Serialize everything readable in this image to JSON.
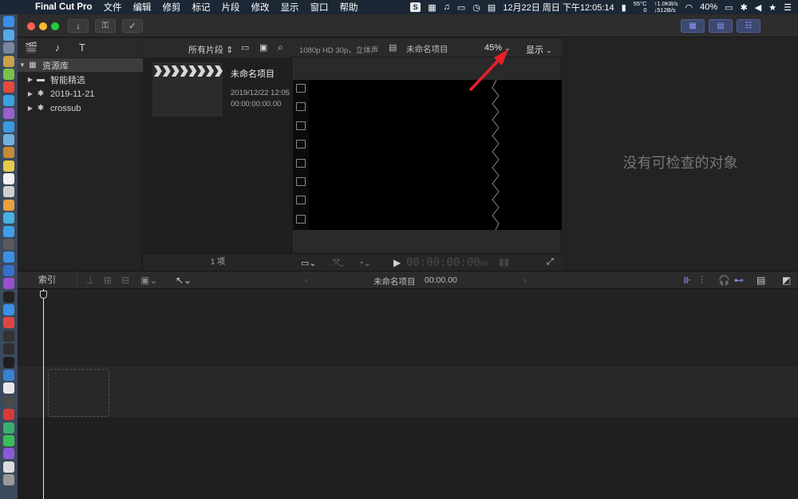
{
  "menubar": {
    "app_name": "Final Cut Pro",
    "items": [
      "文件",
      "编辑",
      "修剪",
      "标记",
      "片段",
      "修改",
      "显示",
      "窗口",
      "帮助"
    ],
    "status": {
      "temp": "55°C",
      "temp_sub": "0",
      "net_up": "↑1.0KB/s",
      "net_down": "↓512B/s",
      "date_time": "12月22日 周日 下午12:05:14",
      "battery": "40%"
    }
  },
  "library": {
    "root_label": "资源库",
    "items": [
      "智能精选",
      "2019-11-21",
      "crossub"
    ]
  },
  "browser": {
    "filter_label": "所有片段",
    "clip": {
      "name": "未命名项目",
      "date": "2019/12/22 12:05",
      "duration": "00:00:00:00.00"
    },
    "item_count": "1 项"
  },
  "viewer": {
    "format": "1080p HD 30p，立体声",
    "project_name": "未命名项目",
    "zoom": "45%",
    "view_label": "显示",
    "timecode": "00:00:00:00",
    "timecode_frames": "00"
  },
  "inspector": {
    "empty_text": "没有可检查的对象"
  },
  "timeline": {
    "index_label": "索引",
    "project_name": "未命名项目",
    "timecode": "00:00.00"
  },
  "colors": {
    "accent": "#8c9cff",
    "menubar": "#1c2735",
    "annotation_arrow": "#e8202a"
  }
}
